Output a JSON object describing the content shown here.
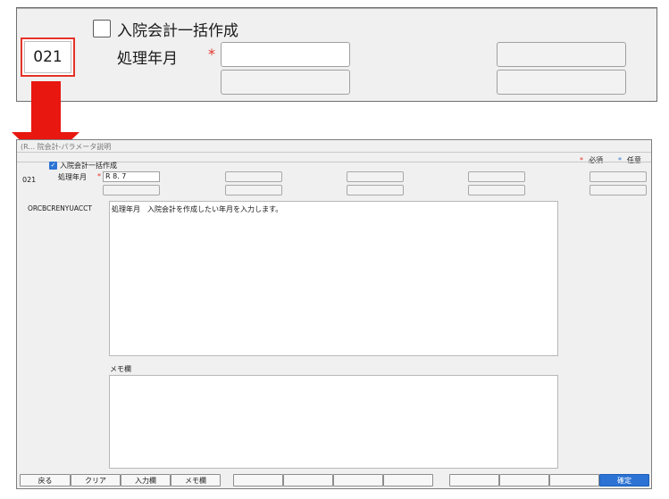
{
  "zoom": {
    "checkbox_label": "入院会計一括作成",
    "code": "021",
    "field_label": "処理年月",
    "required_mark": "*"
  },
  "window": {
    "title": "(R... 院会計-パラメータ説明",
    "legend": {
      "required_mark": "*",
      "required_label": "必須",
      "optional_mark": "*",
      "optional_label": "任意"
    },
    "checkbox_label": "入院会計一括作成",
    "checkbox_checked": true,
    "code": "021",
    "field_label": "処理年月",
    "required_mark": "*",
    "field_value": "R 8. 7",
    "param_name": "ORCBCRENYUACCT",
    "description": "処理年月　入院会計を作成したい年月を入力します。",
    "memo_label": "メモ欄",
    "memo_value": ""
  },
  "buttons": {
    "back": "戻る",
    "clear": "クリア",
    "input_field": "入力欄",
    "memo_field": "メモ欄",
    "confirm": "確定"
  },
  "colors": {
    "accent_red": "#e8170f",
    "checkbox_blue": "#2c73d4",
    "confirm_button": "#2c73d4"
  }
}
